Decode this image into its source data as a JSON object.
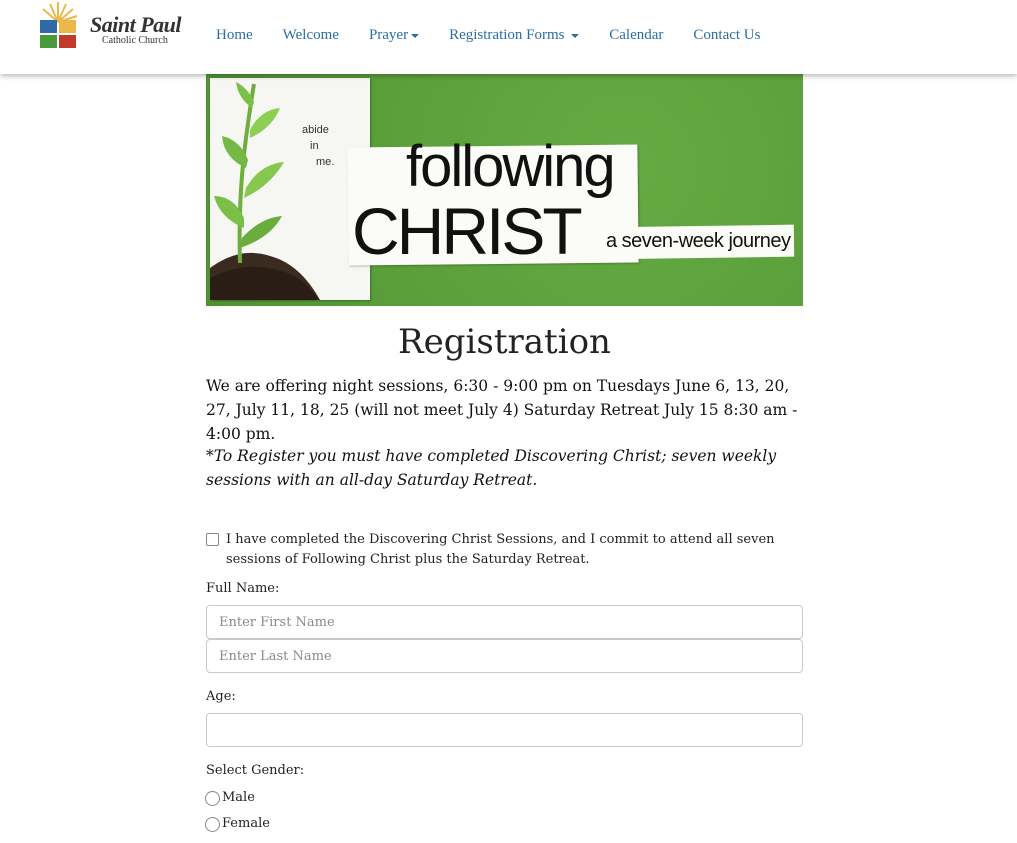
{
  "brand": {
    "name": "Saint Paul",
    "subtitle": "Catholic Church",
    "colors": {
      "sun": "#e8b84a",
      "blue": "#2f6aa7",
      "green": "#4a9a3c",
      "red": "#c0392b"
    }
  },
  "nav": {
    "items": [
      {
        "label": "Home",
        "dropdown": false
      },
      {
        "label": "Welcome",
        "dropdown": false
      },
      {
        "label": "Prayer",
        "dropdown": true
      },
      {
        "label": "Registration Forms",
        "dropdown": true
      },
      {
        "label": "Calendar",
        "dropdown": false
      },
      {
        "label": "Contact Us",
        "dropdown": false
      }
    ],
    "link_color": "#2b6ea3"
  },
  "banner": {
    "abide": [
      "abide",
      "in",
      "me."
    ],
    "title_line1": "following",
    "title_line2": "CHRIST",
    "subtitle": "a seven-week journey",
    "background": "#5a9e3a"
  },
  "page": {
    "title": "Registration",
    "intro": "We are offering night sessions, 6:30 - 9:00 pm on Tuesdays June 6, 13, 20, 27, July 11, 18, 25 (will not meet July 4) Saturday Retreat July 15 8:30 am - 4:00 pm.",
    "note": "*To Register you must have completed Discovering Christ; seven weekly sessions with an all-day Saturday Retreat."
  },
  "form": {
    "commit_label": "I have completed the Discovering Christ Sessions, and I commit to attend all seven sessions of Following Christ plus the Saturday Retreat.",
    "commit_checked": false,
    "full_name_label": "Full Name:",
    "first_name_placeholder": "Enter First Name",
    "last_name_placeholder": "Enter Last Name",
    "age_label": "Age:",
    "age_value": "",
    "gender_label": "Select Gender:",
    "gender_options": [
      "Male",
      "Female"
    ],
    "gender_selected": null
  }
}
